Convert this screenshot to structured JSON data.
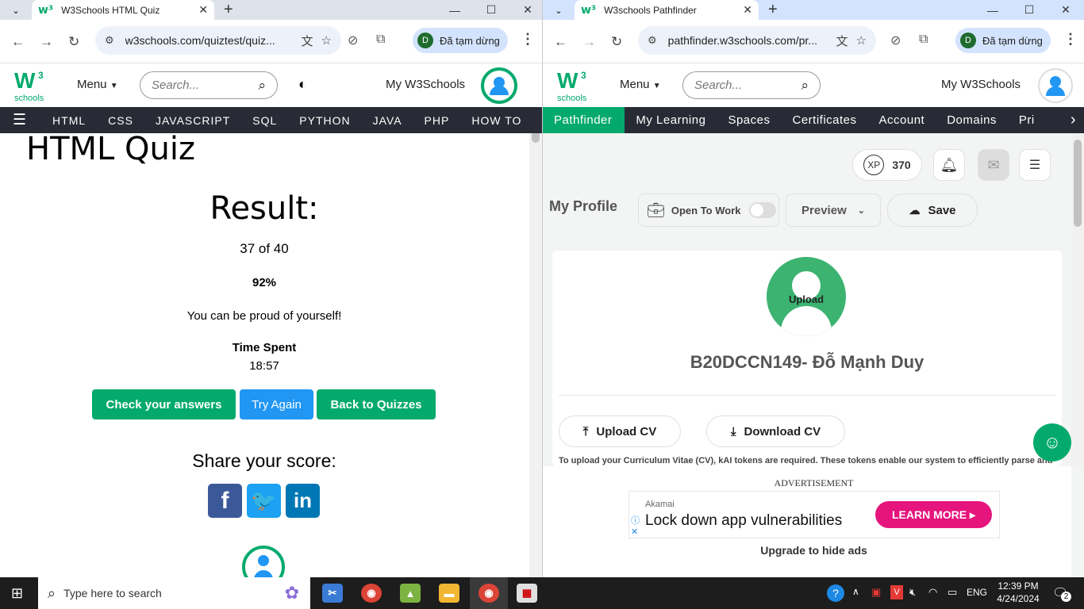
{
  "left_window": {
    "tab_title": "W3Schools HTML Quiz",
    "url": "w3schools.com/quiztest/quiz...",
    "profile_status": "Đã tạm dừng",
    "profile_initial": "D",
    "site": {
      "logo_text": "W",
      "logo_sup": "3",
      "logo_sub": "schools",
      "menu_label": "Menu",
      "search_placeholder": "Search...",
      "my_w3schools": "My W3Schools",
      "nav_items": [
        "HTML",
        "CSS",
        "JAVASCRIPT",
        "SQL",
        "PYTHON",
        "JAVA",
        "PHP",
        "HOW TO"
      ]
    },
    "quiz": {
      "title": "HTML Quiz",
      "result_heading": "Result:",
      "score": "37 of 40",
      "percent": "92%",
      "message": "You can be proud of yourself!",
      "time_spent_label": "Time Spent",
      "time_spent": "18:57",
      "buttons": [
        "Check your answers",
        "Try Again",
        "Back to Quizzes"
      ],
      "share_heading": "Share your score:"
    }
  },
  "right_window": {
    "tab_title": "W3schools Pathfinder",
    "url": "pathfinder.w3schools.com/pr...",
    "profile_status": "Đã tạm dừng",
    "profile_initial": "D",
    "site": {
      "menu_label": "Menu",
      "search_placeholder": "Search...",
      "my_w3schools": "My W3Schools",
      "nav_items": [
        "Pathfinder",
        "My Learning",
        "Spaces",
        "Certificates",
        "Account",
        "Domains",
        "Pri"
      ]
    },
    "profile": {
      "xp_label": "XP",
      "xp_value": "370",
      "heading": "My Profile",
      "open_to_work": "Open To Work",
      "open_to_work_enabled": false,
      "preview_label": "Preview",
      "save_label": "Save",
      "upload_label": "Upload",
      "name": "B20DCCN149- Đỗ Mạnh Duy",
      "upload_cv": "Upload CV",
      "download_cv": "Download CV",
      "cv_note": "To upload your Curriculum Vitae (CV), kAI tokens are required. These tokens enable our system to efficiently parse and"
    },
    "ad": {
      "label": "ADVERTISEMENT",
      "brand": "Akamai",
      "headline": "Lock down app vulnerabilities",
      "cta": "LEARN MORE",
      "upgrade": "Upgrade to hide ads"
    }
  },
  "taskbar": {
    "search_placeholder": "Type here to search",
    "language": "ENG",
    "time": "12:39 PM",
    "date": "4/24/2024",
    "notification_count": "2"
  },
  "colors": {
    "w3_green": "#04aa6d",
    "nav_dark": "#282a35",
    "try_again_blue": "#2196f3",
    "facebook": "#3b5998",
    "twitter": "#1da1f2",
    "linkedin": "#0077b5",
    "ad_cta": "#e6147d"
  }
}
